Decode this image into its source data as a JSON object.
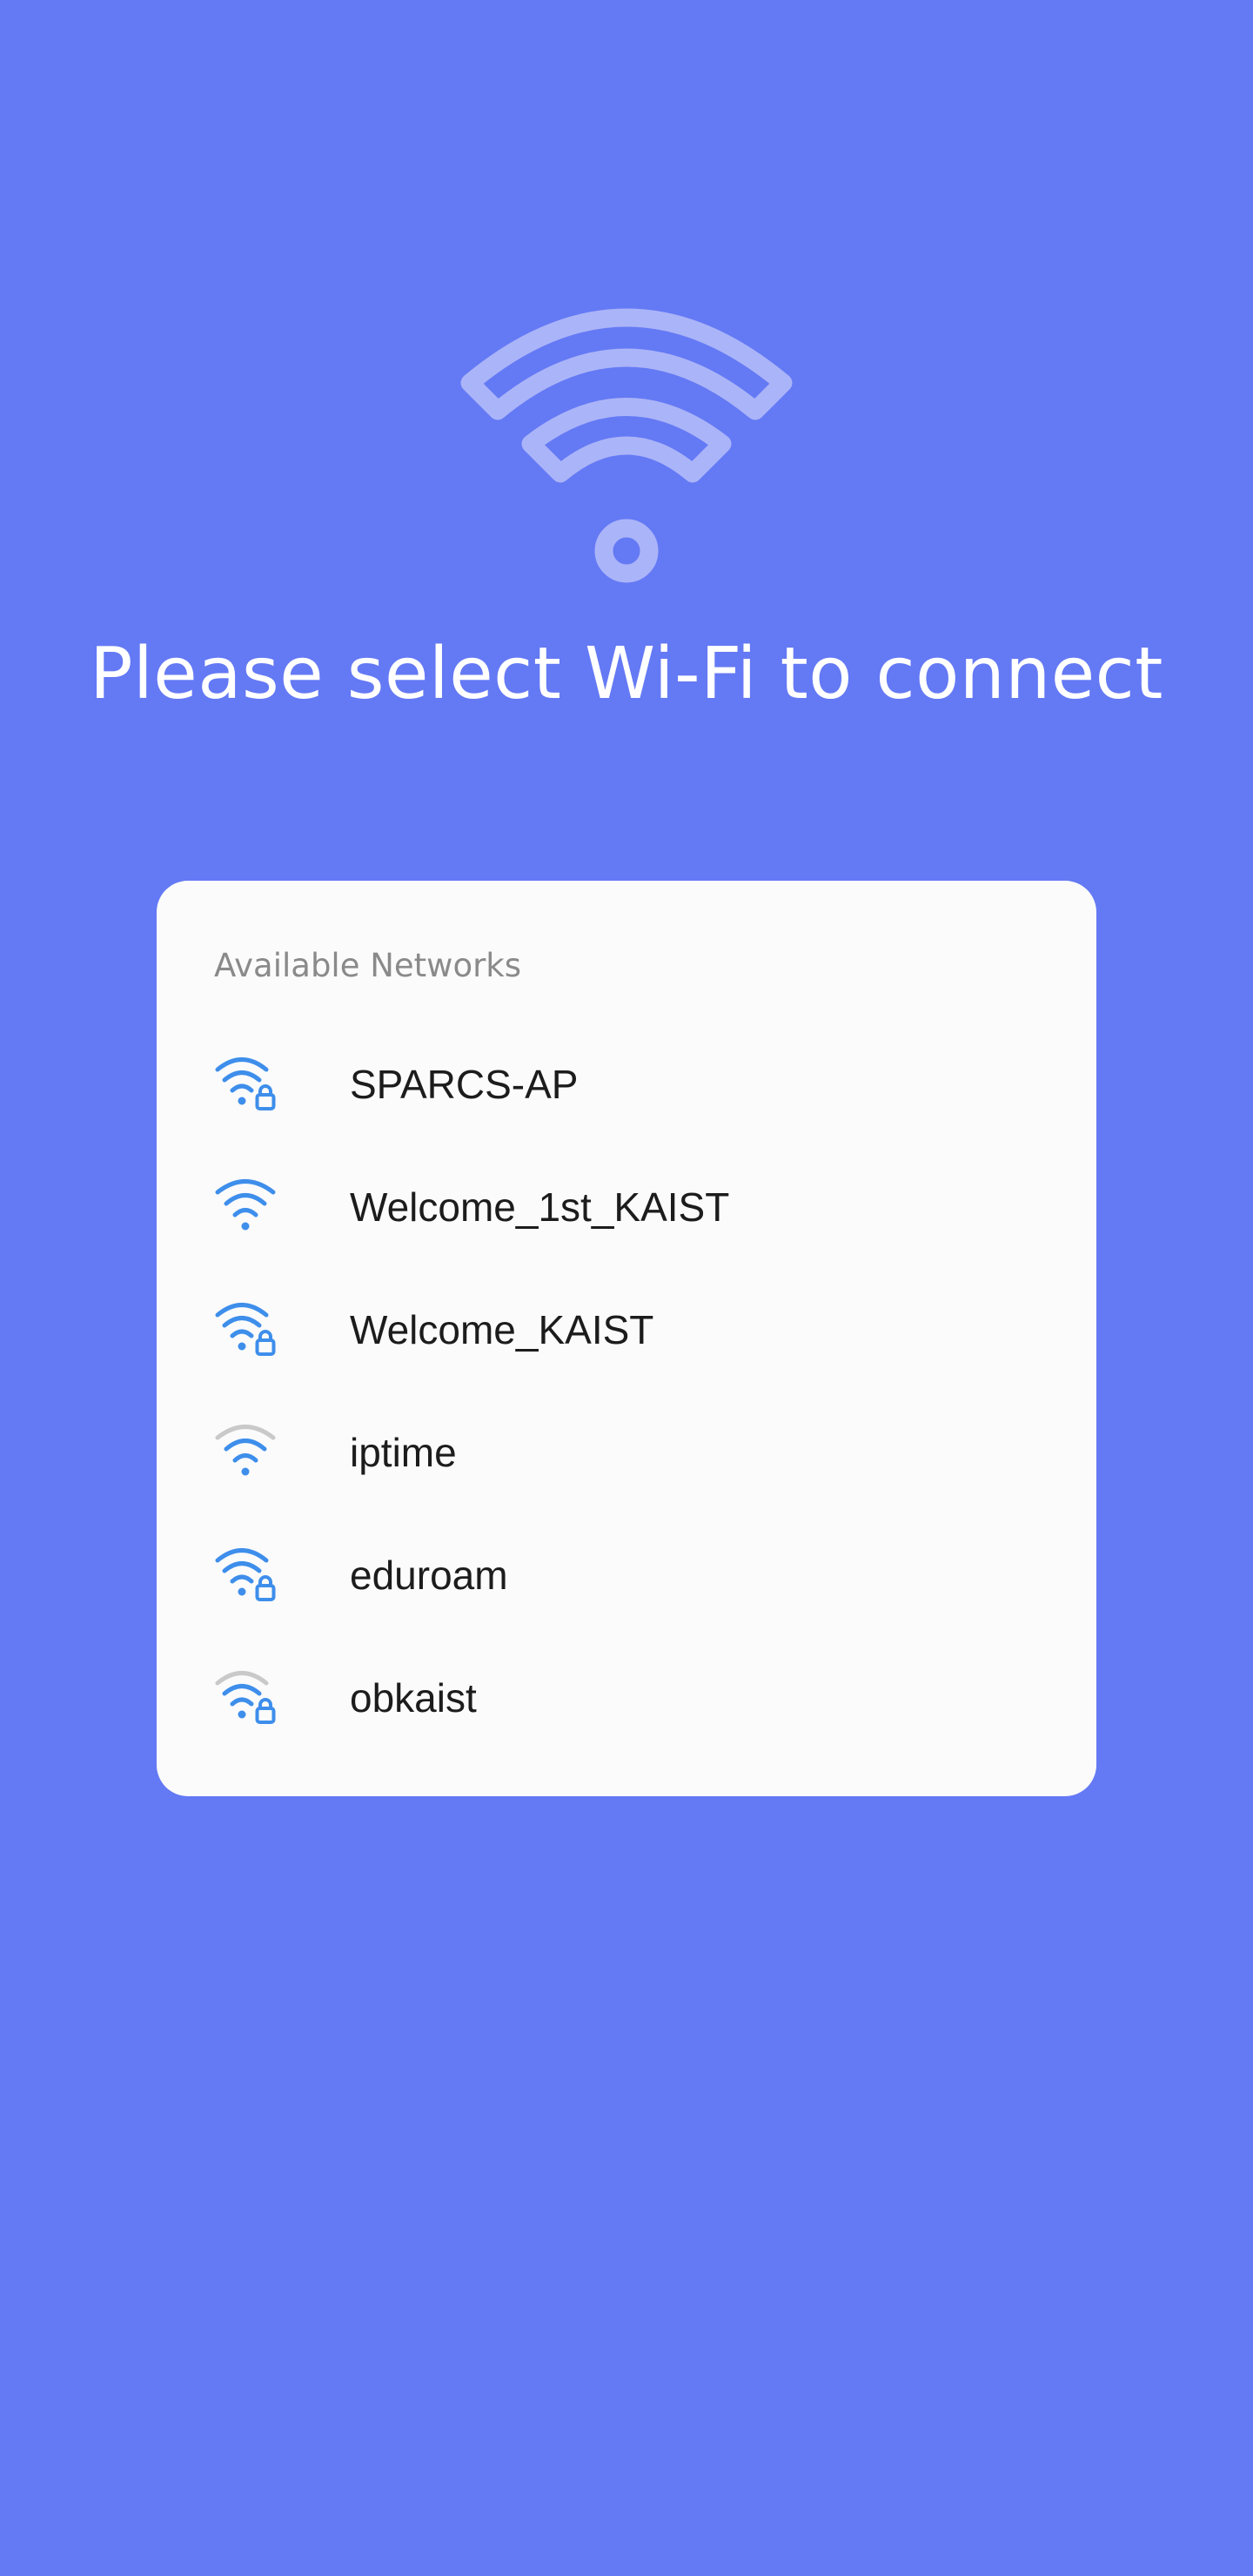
{
  "colors": {
    "background": "#6479F4",
    "card": "#FBFBFB",
    "hero_icon": "#AAB4F8",
    "signal_active": "#3E8EEB",
    "signal_weak": "#C9C9C9",
    "title_text": "#FFFFFF",
    "header_text": "#8A8A8A",
    "item_text": "#1C1C1C"
  },
  "hero": {
    "icon": "wifi-icon",
    "title": "Please select Wi-Fi to connect"
  },
  "networks_card": {
    "header": "Available Networks",
    "items": [
      {
        "name": "SPARCS-AP",
        "icon": "wifi-locked-icon",
        "signal_bars": 3,
        "secured": true
      },
      {
        "name": "Welcome_1st_KAIST",
        "icon": "wifi-icon",
        "signal_bars": 3,
        "secured": false
      },
      {
        "name": "Welcome_KAIST",
        "icon": "wifi-locked-icon",
        "signal_bars": 3,
        "secured": true
      },
      {
        "name": "iptime",
        "icon": "wifi-icon",
        "signal_bars": 2,
        "secured": false
      },
      {
        "name": "eduroam",
        "icon": "wifi-locked-icon",
        "signal_bars": 3,
        "secured": true
      },
      {
        "name": "obkaist",
        "icon": "wifi-locked-icon",
        "signal_bars": 2,
        "secured": true
      }
    ]
  }
}
